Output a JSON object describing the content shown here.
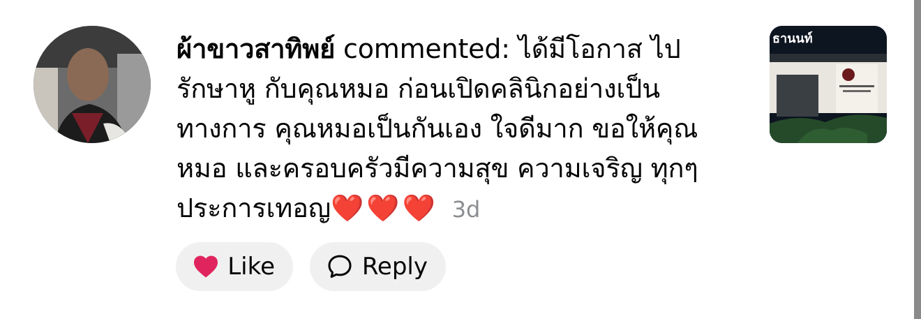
{
  "comment": {
    "author": "ผ้าขาวสาทิพย์",
    "action": "commented:",
    "text": "ได้มีโอกาส ไปรักษาหู กับคุณหมอ ก่อนเปิดคลินิกอย่างเป็นทางการ คุณหมอเป็นกันเอง ใจดีมาก ขอให้คุณหมอ และครอบครัวมีความสุข ความเจริญ ทุกๆประการเทอญ",
    "emoji": "❤️❤️❤️",
    "age": "3d"
  },
  "thumbnail": {
    "sign_text": "ธานนท์"
  },
  "actions": {
    "like_label": "Like",
    "reply_label": "Reply"
  },
  "icons": {
    "like": "heart-icon",
    "reply": "speech-bubble-icon"
  },
  "colors": {
    "like_heart": "#e0245e",
    "pill_bg": "#f0f0f0",
    "meta_gray": "#8a8d91"
  }
}
